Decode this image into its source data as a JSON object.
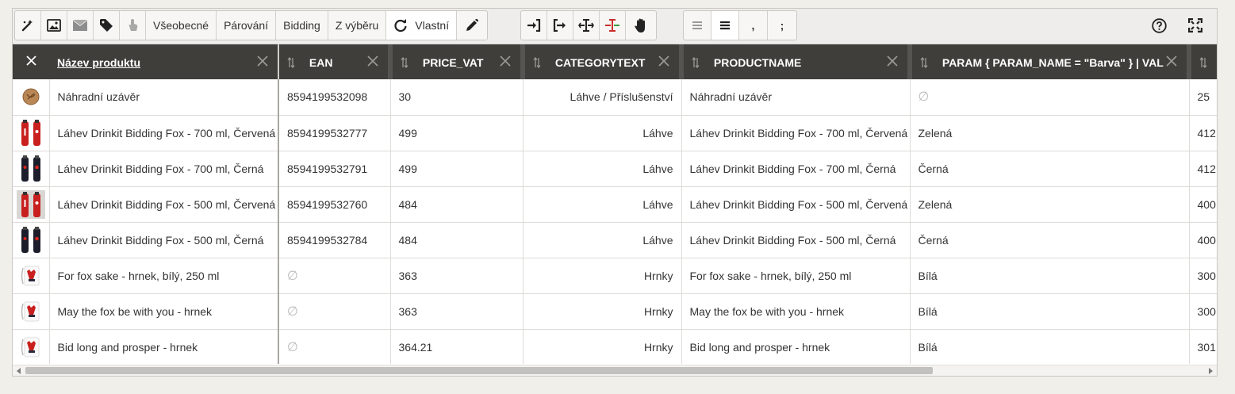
{
  "toolbar": {
    "tabs": [
      "Všeobecné",
      "Párování",
      "Bidding",
      "Z výběru",
      "Vlastní"
    ],
    "active_tab": "Vlastní",
    "icons_left": [
      "magic-wand-icon",
      "image-icon",
      "envelope-icon",
      "tag-icon",
      "touch-icon"
    ],
    "icons_mid": [
      "arrow-right-bracket-icon",
      "exit-icon",
      "column-split-icon",
      "column-split-colored-icon",
      "hand-icon"
    ],
    "icons_format": [
      "lines-light-icon",
      "lines-bold-icon",
      "comma-icon",
      "semicolon-icon"
    ],
    "comma_glyph": ",",
    "semicolon_glyph": ";",
    "icons_right": [
      "help-icon",
      "fullscreen-icon"
    ]
  },
  "table": {
    "columns": [
      {
        "label": "Název produktu"
      },
      {
        "label": "EAN"
      },
      {
        "label": "PRICE_VAT"
      },
      {
        "label": "CATEGORYTEXT"
      },
      {
        "label": "PRODUCTNAME"
      },
      {
        "label": "PARAM { PARAM_NAME = \"Barva\" } | VAL"
      }
    ],
    "null_glyph": "∅",
    "rows": [
      {
        "thumb": "cap",
        "name": "Náhradní uzávěr",
        "ean": "8594199532098",
        "price": "30",
        "category": "Láhve / Příslušenství",
        "productname": "Náhradní uzávěr",
        "param": "",
        "extra": "25"
      },
      {
        "thumb": "bottle-red",
        "name": "Láhev Drinkit Bidding Fox - 700 ml, Červená",
        "ean": "8594199532777",
        "price": "499",
        "category": "Láhve",
        "productname": "Láhev Drinkit Bidding Fox - 700 ml, Červená",
        "param": "Zelená",
        "extra": "412"
      },
      {
        "thumb": "bottle-black",
        "name": "Láhev Drinkit Bidding Fox - 700 ml, Černá",
        "ean": "8594199532791",
        "price": "499",
        "category": "Láhve",
        "productname": "Láhev Drinkit Bidding Fox - 700 ml, Černá",
        "param": "Černá",
        "extra": "412"
      },
      {
        "thumb": "bottle-red-bg",
        "name": "Láhev Drinkit Bidding Fox - 500 ml, Červená",
        "ean": "8594199532760",
        "price": "484",
        "category": "Láhve",
        "productname": "Láhev Drinkit Bidding Fox - 500 ml, Červená",
        "param": "Zelená",
        "extra": "400"
      },
      {
        "thumb": "bottle-black",
        "name": "Láhev Drinkit Bidding Fox - 500 ml, Černá",
        "ean": "8594199532784",
        "price": "484",
        "category": "Láhve",
        "productname": "Láhev Drinkit Bidding Fox - 500 ml, Černá",
        "param": "Černá",
        "extra": "400"
      },
      {
        "thumb": "mug",
        "name": "For fox sake - hrnek, bílý, 250 ml",
        "ean": "",
        "price": "363",
        "category": "Hrnky",
        "productname": "For fox sake - hrnek, bílý, 250 ml",
        "param": "Bílá",
        "extra": "300"
      },
      {
        "thumb": "mug",
        "name": "May the fox be with you - hrnek",
        "ean": "",
        "price": "363",
        "category": "Hrnky",
        "productname": "May the fox be with you - hrnek",
        "param": "Bílá",
        "extra": "300"
      },
      {
        "thumb": "mug",
        "name": "Bid long and prosper - hrnek",
        "ean": "",
        "price": "364.21",
        "category": "Hrnky",
        "productname": "Bid long and prosper - hrnek",
        "param": "Bílá",
        "extra": "301"
      }
    ]
  },
  "colors": {
    "header_bg": "#3f3e3a",
    "bottle_red": "#c8201e",
    "bottle_black": "#1c1f2b"
  }
}
